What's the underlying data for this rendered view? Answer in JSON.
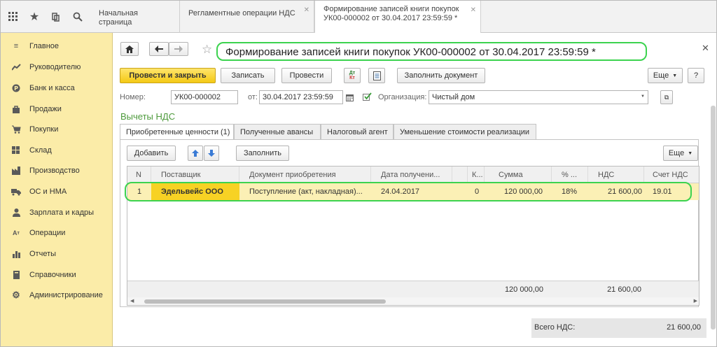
{
  "topbar": {
    "tabs": [
      {
        "label": "Начальная страница"
      },
      {
        "label": "Регламентные операции НДС"
      },
      {
        "label_line1": "Формирование записей книги покупок",
        "label_line2": "УК00-000002 от 30.04.2017 23:59:59 *"
      }
    ]
  },
  "sidebar": {
    "items": [
      {
        "label": "Главное",
        "icon": "menu-icon"
      },
      {
        "label": "Руководителю",
        "icon": "trend-icon"
      },
      {
        "label": "Банк и касса",
        "icon": "ruble-icon"
      },
      {
        "label": "Продажи",
        "icon": "bag-icon"
      },
      {
        "label": "Покупки",
        "icon": "cart-icon"
      },
      {
        "label": "Склад",
        "icon": "warehouse-icon"
      },
      {
        "label": "Производство",
        "icon": "factory-icon"
      },
      {
        "label": "ОС и НМА",
        "icon": "truck-icon"
      },
      {
        "label": "Зарплата и кадры",
        "icon": "person-icon"
      },
      {
        "label": "Операции",
        "icon": "operations-icon"
      },
      {
        "label": "Отчеты",
        "icon": "chart-icon"
      },
      {
        "label": "Справочники",
        "icon": "book-icon"
      },
      {
        "label": "Администрирование",
        "icon": "gear-icon"
      }
    ]
  },
  "document": {
    "title": "Формирование записей книги покупок УК00-000002 от 30.04.2017 23:59:59 *",
    "toolbar": {
      "post_and_close": "Провести и закрыть",
      "save": "Записать",
      "post": "Провести",
      "fill_document": "Заполнить документ",
      "more": "Еще",
      "help": "?"
    },
    "fields": {
      "number_label": "Номер:",
      "number_value": "УК00-000002",
      "date_label": "от:",
      "date_value": "30.04.2017 23:59:59",
      "org_label": "Организация:",
      "org_value": "Чистый дом"
    },
    "section_title": "Вычеты НДС",
    "tabs": [
      {
        "label": "Приобретенные ценности (1)"
      },
      {
        "label": "Полученные авансы"
      },
      {
        "label": "Налоговый агент"
      },
      {
        "label": "Уменьшение стоимости реализации"
      }
    ],
    "table_toolbar": {
      "add": "Добавить",
      "fill": "Заполнить",
      "more": "Еще"
    },
    "table": {
      "columns": [
        "N",
        "Поставщик",
        "Документ приобретения",
        "Дата получени...",
        "К...",
        "Сумма",
        "% ...",
        "НДС",
        "Счет НДС"
      ],
      "rows": [
        {
          "n": "1",
          "supplier": "Эдельвейс ООО",
          "doc": "Поступление (акт, накладная)...",
          "date": "24.04.2017",
          "k": "0",
          "sum": "120 000,00",
          "pct": "18%",
          "vat": "21 600,00",
          "account": "19.01"
        }
      ],
      "footer": {
        "sum": "120 000,00",
        "vat": "21 600,00"
      }
    },
    "total": {
      "label": "Всего НДС:",
      "value": "21 600,00"
    }
  }
}
